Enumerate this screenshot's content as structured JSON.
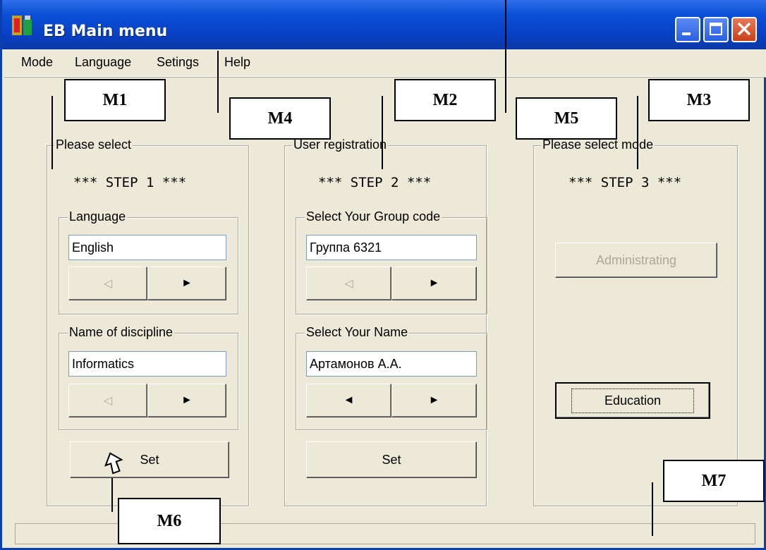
{
  "window": {
    "title": "EB Main menu"
  },
  "menu": {
    "items": [
      {
        "label": "Mode"
      },
      {
        "label": "Language"
      },
      {
        "label": "Setings"
      },
      {
        "label": "Help"
      }
    ]
  },
  "step1": {
    "group_title": "Please select",
    "step_label": "*** STEP 1 ***",
    "language": {
      "title": "Language",
      "value": "English"
    },
    "discipline": {
      "title": "Name of discipline",
      "value": "Informatics"
    },
    "set_label": "Set"
  },
  "step2": {
    "group_title": "User registration",
    "step_label": "*** STEP 2 ***",
    "group_code": {
      "title": "Select Your Group code",
      "value": "Группа 6321"
    },
    "name": {
      "title": "Select Your Name",
      "value": "Артамонов А.А."
    },
    "set_label": "Set"
  },
  "step3": {
    "group_title": "Please select mode",
    "step_label": "*** STEP 3 ***",
    "administrating_label": "Administrating",
    "education_label": "Education"
  },
  "annotations": [
    "M1",
    "M2",
    "M3",
    "M4",
    "M5",
    "M6",
    "M7"
  ],
  "colors": {
    "titlebar": "#0a4fd6",
    "window_bg": "#ece9d8"
  }
}
